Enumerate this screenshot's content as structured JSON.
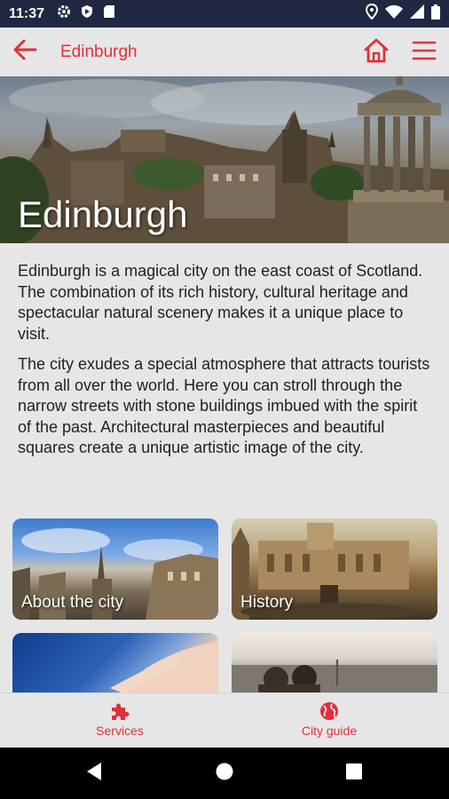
{
  "status_bar": {
    "time": "11:37",
    "left_icons": [
      "gear-icon",
      "shield-icon",
      "sim-card-icon"
    ],
    "right_icons": [
      "location-icon",
      "wifi-icon",
      "signal-icon",
      "battery-icon"
    ]
  },
  "app_bar": {
    "title": "Edinburgh",
    "accent_color": "#e0303a"
  },
  "hero": {
    "title": "Edinburgh"
  },
  "intro": {
    "paragraphs": [
      "Edinburgh is a magical city on the east coast of Scotland. The combination of its rich history, cultural heritage and spectacular natural scenery makes it a unique place to visit.",
      "The city exudes a special atmosphere that attracts tourists from all over the world. Here you can stroll through the narrow streets with stone buildings imbued with the spirit of the past. Architectural masterpieces and beautiful squares create a unique artistic image of the city."
    ]
  },
  "cards": [
    {
      "label": "About the city"
    },
    {
      "label": "History"
    },
    {
      "label": ""
    },
    {
      "label": ""
    }
  ],
  "bottom_nav": {
    "services": "Services",
    "city_guide": "City guide"
  },
  "colors": {
    "accent": "#e0303a",
    "status_bar": "#1f2741",
    "background": "#e6e6e6"
  }
}
